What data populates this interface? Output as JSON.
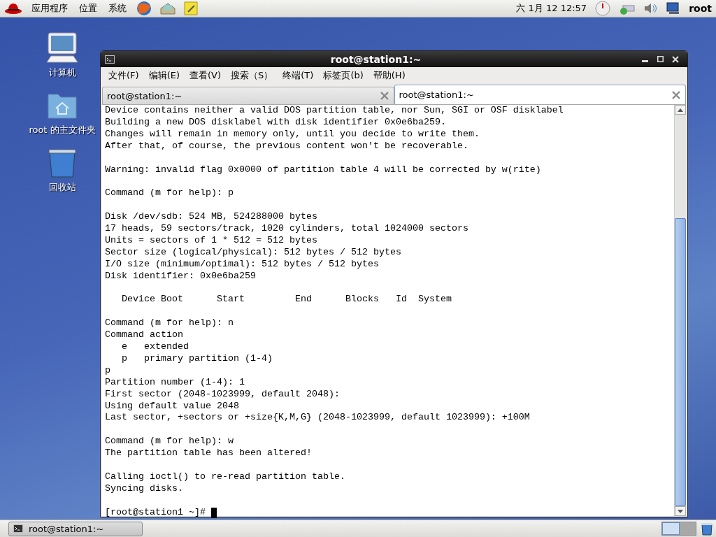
{
  "top_panel": {
    "menus": [
      "应用程序",
      "位置",
      "系统"
    ],
    "clock": "六 1月 12 12:57",
    "user": "root"
  },
  "desktop_icons": [
    {
      "kind": "computer",
      "label": "计算机"
    },
    {
      "kind": "home",
      "label": "root 的主文件夹"
    },
    {
      "kind": "trash",
      "label": "回收站"
    }
  ],
  "window": {
    "title": "root@station1:~",
    "menu": [
      "文件(F)",
      "编辑(E)",
      "查看(V)",
      "搜索（S）",
      "终端(T)",
      "标签页(b)",
      "帮助(H)"
    ],
    "tabs": [
      {
        "label": "root@station1:~",
        "selected": false
      },
      {
        "label": "root@station1:~",
        "selected": true
      }
    ],
    "terminal": {
      "paragraphs": [
        [
          "Device contains neither a valid DOS partition table, nor Sun, SGI or OSF disklabel",
          "Building a new DOS disklabel with disk identifier 0x0e6ba259.",
          "Changes will remain in memory only, until you decide to write them.",
          "After that, of course, the previous content won't be recoverable."
        ],
        [
          "Warning: invalid flag 0x0000 of partition table 4 will be corrected by w(rite)"
        ],
        [
          "Command (m for help): p"
        ],
        [
          "Disk /dev/sdb: 524 MB, 524288000 bytes",
          "17 heads, 59 sectors/track, 1020 cylinders, total 1024000 sectors",
          "Units = sectors of 1 * 512 = 512 bytes",
          "Sector size (logical/physical): 512 bytes / 512 bytes",
          "I/O size (minimum/optimal): 512 bytes / 512 bytes",
          "Disk identifier: 0x0e6ba259"
        ],
        [
          "   Device Boot      Start         End      Blocks   Id  System"
        ],
        [
          "Command (m for help): n",
          "Command action",
          "   e   extended",
          "   p   primary partition (1-4)",
          "p",
          "Partition number (1-4): 1",
          "First sector (2048-1023999, default 2048):",
          "Using default value 2048",
          "Last sector, +sectors or +size{K,M,G} (2048-1023999, default 1023999): +100M"
        ],
        [
          "Command (m for help): w",
          "The partition table has been altered!"
        ],
        [
          "Calling ioctl() to re-read partition table.",
          "Syncing disks."
        ]
      ],
      "prompt": "[root@station1 ~]#"
    }
  },
  "taskbar": {
    "tasks": [
      {
        "label": "root@station1:~"
      }
    ]
  }
}
